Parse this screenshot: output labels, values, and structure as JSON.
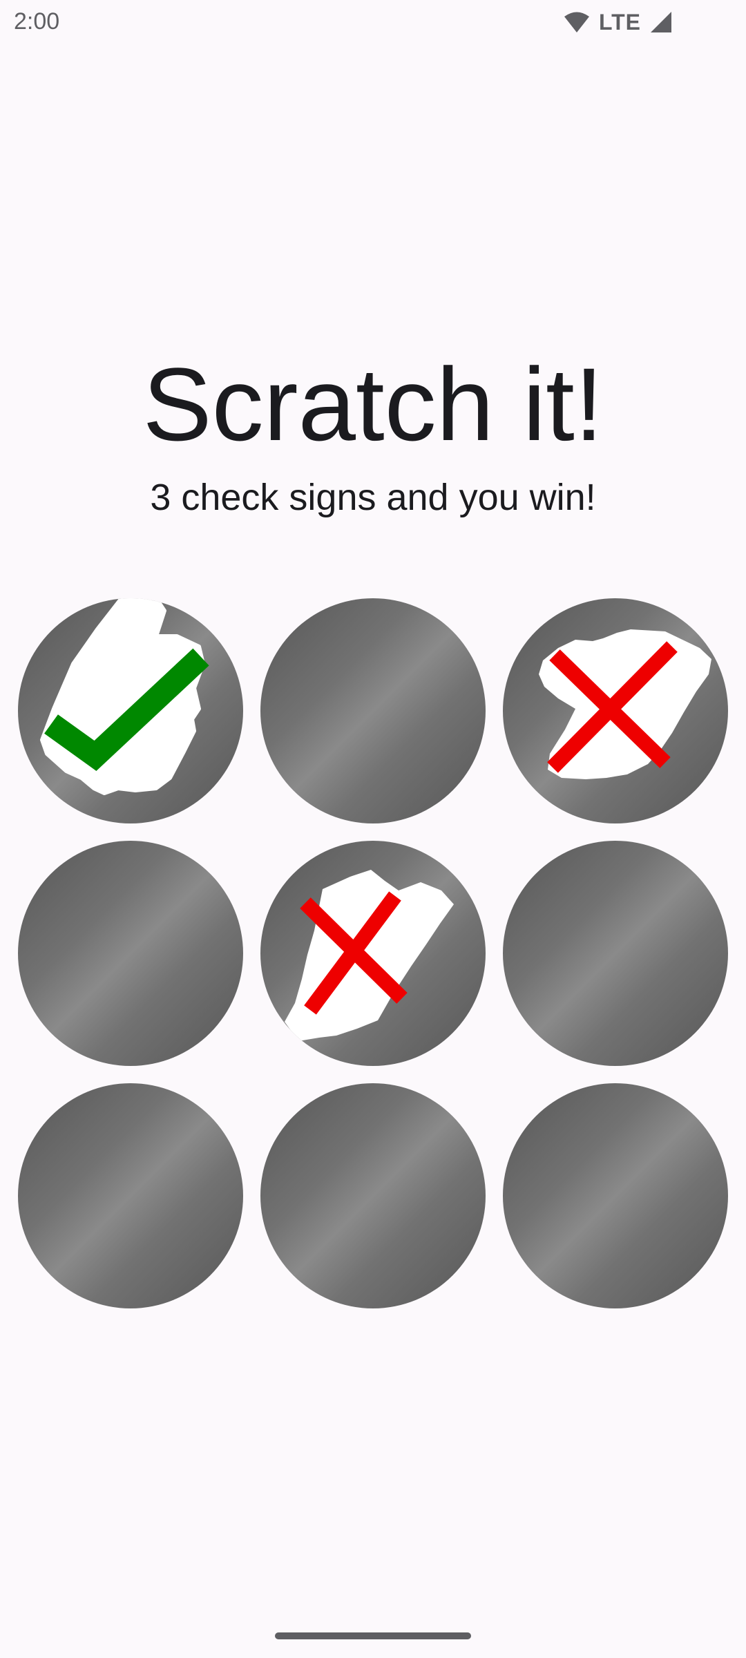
{
  "status_bar": {
    "time": "2:00",
    "network": "LTE",
    "icons": [
      "wifi-icon",
      "cellular-signal-icon"
    ]
  },
  "header": {
    "title": "Scratch it!",
    "subtitle": "3 check signs and you win!"
  },
  "grid": {
    "rows": 3,
    "columns": 3,
    "cells": [
      {
        "row": 1,
        "col": 1,
        "state": "scratched",
        "symbol": "check",
        "symbol_color": "#008800"
      },
      {
        "row": 1,
        "col": 2,
        "state": "covered"
      },
      {
        "row": 1,
        "col": 3,
        "state": "scratched",
        "symbol": "cross",
        "symbol_color": "#ee0000"
      },
      {
        "row": 2,
        "col": 1,
        "state": "covered"
      },
      {
        "row": 2,
        "col": 2,
        "state": "scratched",
        "symbol": "cross",
        "symbol_color": "#ee0000"
      },
      {
        "row": 2,
        "col": 3,
        "state": "covered"
      },
      {
        "row": 3,
        "col": 1,
        "state": "covered"
      },
      {
        "row": 3,
        "col": 2,
        "state": "covered"
      },
      {
        "row": 3,
        "col": 3,
        "state": "covered"
      }
    ]
  },
  "colors": {
    "background": "#fcf9fc",
    "text": "#1b1b1f",
    "scratch_surface": "#757575",
    "check": "#008800",
    "cross": "#ee0000"
  }
}
